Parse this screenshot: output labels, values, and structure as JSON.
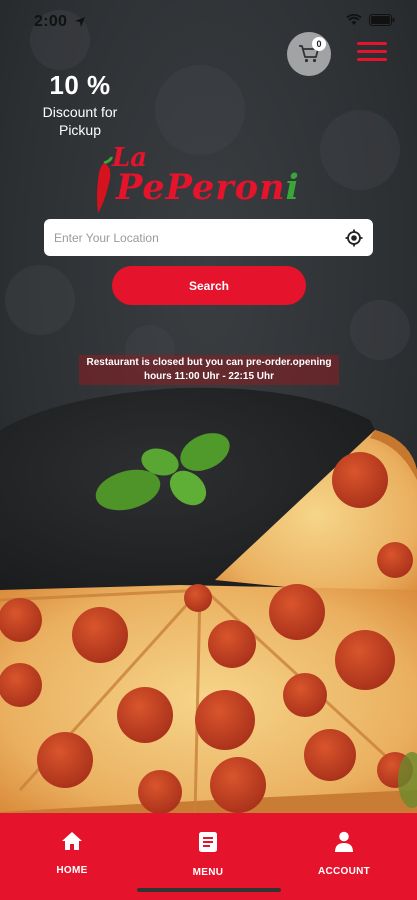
{
  "status_bar": {
    "time": "2:00"
  },
  "header": {
    "cart_count": "0",
    "cart_icon": "cart-icon",
    "menu_icon": "hamburger-menu-icon"
  },
  "discount": {
    "percent": "10 %",
    "text": "Discount for Pickup"
  },
  "logo": {
    "prefix": "La",
    "name_red": "PePeron",
    "name_green": "i"
  },
  "location": {
    "placeholder": "Enter Your Location",
    "value": "",
    "icon": "locate-icon"
  },
  "search": {
    "label": "Search"
  },
  "notice": {
    "text": "Restaurant is closed but you can pre-order.opening hours 11:00 Uhr - 22:15 Uhr"
  },
  "bottom_nav": {
    "items": [
      {
        "label": "HOME",
        "icon": "home-icon"
      },
      {
        "label": "MENU",
        "icon": "menu-card-icon"
      },
      {
        "label": "ACCOUNT",
        "icon": "account-icon"
      }
    ]
  },
  "colors": {
    "brand_red": "#e5132b",
    "brand_green": "#3aa63a",
    "background": "#2a2d30"
  }
}
